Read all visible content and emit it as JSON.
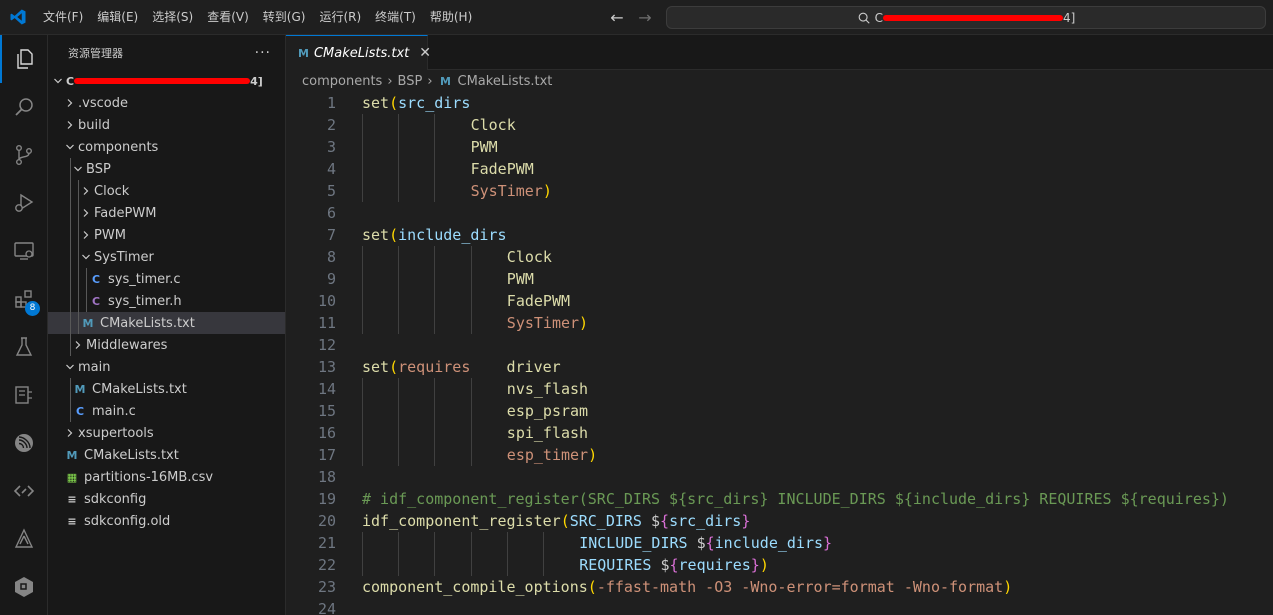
{
  "titlebar": {
    "menu": [
      "文件(F)",
      "编辑(E)",
      "选择(S)",
      "查看(V)",
      "转到(G)",
      "运行(R)",
      "终端(T)",
      "帮助(H)"
    ],
    "back_arrow": "←",
    "forward_arrow": "→",
    "search_prefix": "C",
    "search_suffix": "4]"
  },
  "activitybar": {
    "extensions_badge": "8",
    "icons": [
      "explorer-icon",
      "search-icon",
      "source-control-icon",
      "run-debug-icon",
      "remote-explorer-icon",
      "extensions-icon",
      "testing-icon",
      "serial-monitor-icon",
      "espressif-icon",
      "source-icon",
      "deploy-icon",
      "package-icon"
    ]
  },
  "sidebar": {
    "title": "资源管理器",
    "more": "···",
    "root_prefix": "C",
    "root_suffix": "4]",
    "tree": [
      {
        "label": ".vscode",
        "type": "folder",
        "expanded": false,
        "depth": 1
      },
      {
        "label": "build",
        "type": "folder",
        "expanded": false,
        "depth": 1
      },
      {
        "label": "components",
        "type": "folder",
        "expanded": true,
        "depth": 1
      },
      {
        "label": "BSP",
        "type": "folder",
        "expanded": true,
        "depth": 2
      },
      {
        "label": "Clock",
        "type": "folder",
        "expanded": false,
        "depth": 3
      },
      {
        "label": "FadePWM",
        "type": "folder",
        "expanded": false,
        "depth": 3
      },
      {
        "label": "PWM",
        "type": "folder",
        "expanded": false,
        "depth": 3
      },
      {
        "label": "SysTimer",
        "type": "folder",
        "expanded": true,
        "depth": 3
      },
      {
        "label": "sys_timer.c",
        "type": "c",
        "depth": 4
      },
      {
        "label": "sys_timer.h",
        "type": "h",
        "depth": 4
      },
      {
        "label": "CMakeLists.txt",
        "type": "cmake",
        "depth": 3,
        "selected": true
      },
      {
        "label": "Middlewares",
        "type": "folder",
        "expanded": false,
        "depth": 2
      },
      {
        "label": "main",
        "type": "folder",
        "expanded": true,
        "depth": 1
      },
      {
        "label": "CMakeLists.txt",
        "type": "cmake",
        "depth": 2
      },
      {
        "label": "main.c",
        "type": "c",
        "depth": 2
      },
      {
        "label": "xsupertools",
        "type": "folder",
        "expanded": false,
        "depth": 1
      },
      {
        "label": "CMakeLists.txt",
        "type": "cmake",
        "depth": 1
      },
      {
        "label": "partitions-16MB.csv",
        "type": "csv",
        "depth": 1
      },
      {
        "label": "sdkconfig",
        "type": "config",
        "depth": 1
      },
      {
        "label": "sdkconfig.old",
        "type": "config",
        "depth": 1
      }
    ]
  },
  "editor": {
    "tab": {
      "label": "CMakeLists.txt",
      "close": "✕"
    },
    "breadcrumbs": [
      "components",
      "BSP",
      "CMakeLists.txt"
    ],
    "lines": [
      {
        "n": "1",
        "indent": 0,
        "tokens": [
          [
            "fn",
            "set"
          ],
          [
            "p1",
            "("
          ],
          [
            "var",
            "src_dirs"
          ]
        ]
      },
      {
        "n": "2",
        "indent": 3,
        "tokens": [
          [
            "arg",
            "Clock"
          ]
        ]
      },
      {
        "n": "3",
        "indent": 3,
        "tokens": [
          [
            "arg",
            "PWM"
          ]
        ]
      },
      {
        "n": "4",
        "indent": 3,
        "tokens": [
          [
            "arg",
            "FadePWM"
          ]
        ]
      },
      {
        "n": "5",
        "indent": 3,
        "tokens": [
          [
            "last",
            "SysTimer"
          ],
          [
            "p1",
            ")"
          ]
        ]
      },
      {
        "n": "6",
        "indent": 0,
        "tokens": []
      },
      {
        "n": "7",
        "indent": 0,
        "tokens": [
          [
            "fn",
            "set"
          ],
          [
            "p1",
            "("
          ],
          [
            "var",
            "include_dirs"
          ]
        ]
      },
      {
        "n": "8",
        "indent": 4,
        "tokens": [
          [
            "arg",
            "Clock"
          ]
        ]
      },
      {
        "n": "9",
        "indent": 4,
        "tokens": [
          [
            "arg",
            "PWM"
          ]
        ]
      },
      {
        "n": "10",
        "indent": 4,
        "tokens": [
          [
            "arg",
            "FadePWM"
          ]
        ]
      },
      {
        "n": "11",
        "indent": 4,
        "tokens": [
          [
            "last",
            "SysTimer"
          ],
          [
            "p1",
            ")"
          ]
        ]
      },
      {
        "n": "12",
        "indent": 0,
        "tokens": []
      },
      {
        "n": "13",
        "indent": 0,
        "tokens": [
          [
            "fn",
            "set"
          ],
          [
            "p1",
            "("
          ],
          [
            "kw",
            "requires"
          ],
          [
            "plain",
            "    "
          ],
          [
            "arg",
            "driver"
          ]
        ]
      },
      {
        "n": "14",
        "indent": 4,
        "tokens": [
          [
            "arg",
            "nvs_flash"
          ]
        ]
      },
      {
        "n": "15",
        "indent": 4,
        "tokens": [
          [
            "arg",
            "esp_psram"
          ]
        ]
      },
      {
        "n": "16",
        "indent": 4,
        "tokens": [
          [
            "arg",
            "spi_flash"
          ]
        ]
      },
      {
        "n": "17",
        "indent": 4,
        "tokens": [
          [
            "last",
            "esp_timer"
          ],
          [
            "p1",
            ")"
          ]
        ]
      },
      {
        "n": "18",
        "indent": 0,
        "tokens": []
      },
      {
        "n": "19",
        "indent": 0,
        "tokens": [
          [
            "cm",
            "# idf_component_register(SRC_DIRS ${src_dirs} INCLUDE_DIRS ${include_dirs} REQUIRES ${requires})"
          ]
        ]
      },
      {
        "n": "20",
        "indent": 0,
        "tokens": [
          [
            "fn",
            "idf_component_register"
          ],
          [
            "p1",
            "("
          ],
          [
            "var",
            "SRC_DIRS "
          ],
          [
            "plain",
            "$"
          ],
          [
            "p2",
            "{"
          ],
          [
            "var",
            "src_dirs"
          ],
          [
            "p2",
            "}"
          ]
        ]
      },
      {
        "n": "21",
        "indent": 6,
        "tokens": [
          [
            "var",
            "INCLUDE_DIRS "
          ],
          [
            "plain",
            "$"
          ],
          [
            "p2",
            "{"
          ],
          [
            "var",
            "include_dirs"
          ],
          [
            "p2",
            "}"
          ]
        ]
      },
      {
        "n": "22",
        "indent": 6,
        "tokens": [
          [
            "var",
            "REQUIRES "
          ],
          [
            "plain",
            "$"
          ],
          [
            "p2",
            "{"
          ],
          [
            "var",
            "requires"
          ],
          [
            "p2",
            "}"
          ],
          [
            "p1",
            ")"
          ]
        ]
      },
      {
        "n": "23",
        "indent": 0,
        "tokens": [
          [
            "fn",
            "component_compile_options"
          ],
          [
            "p1",
            "("
          ],
          [
            "str",
            "-ffast-math -O3 -Wno-error=format -Wno-format"
          ],
          [
            "p1",
            ")"
          ]
        ]
      },
      {
        "n": "24",
        "indent": 0,
        "tokens": []
      }
    ]
  }
}
